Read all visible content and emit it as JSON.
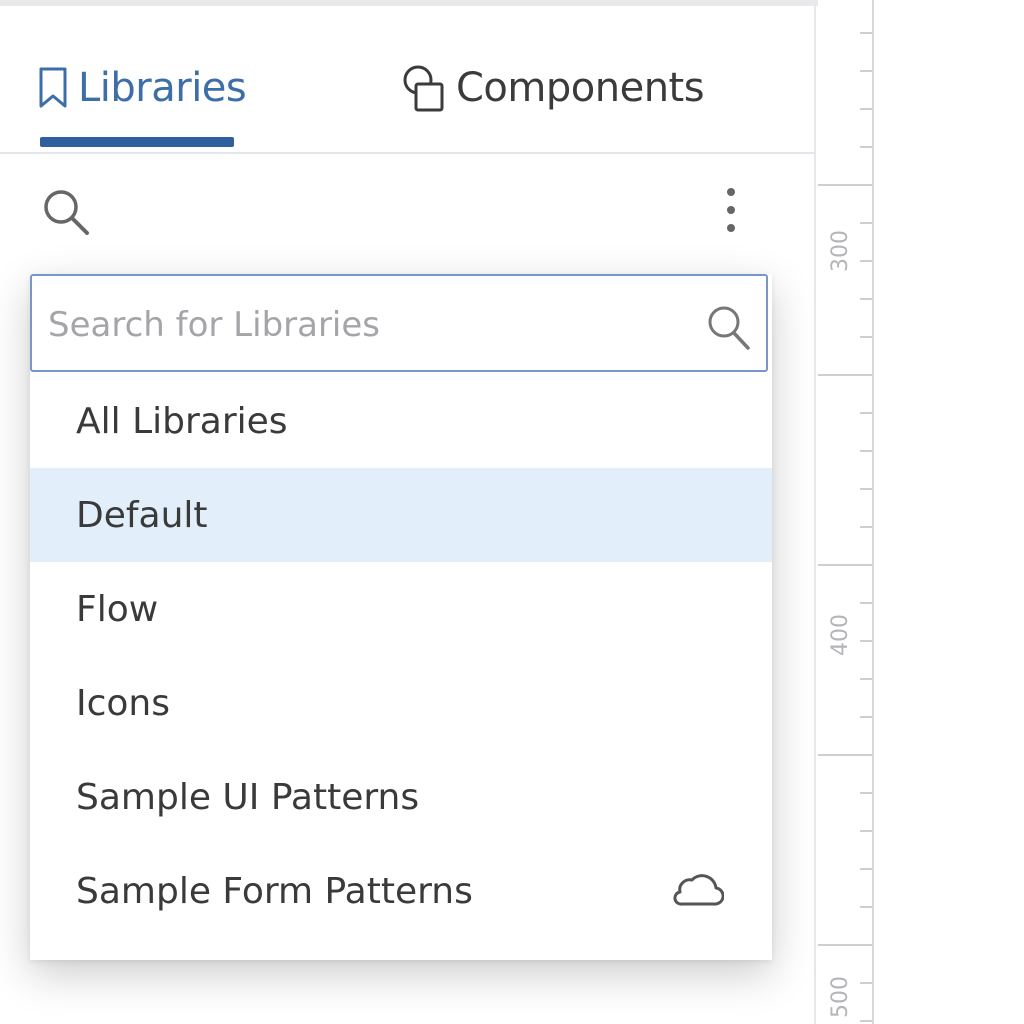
{
  "tabs": [
    {
      "label": "Libraries",
      "icon": "bookmark-icon",
      "active": true
    },
    {
      "label": "Components",
      "icon": "components-icon",
      "active": false
    }
  ],
  "toolbar": {
    "search_icon": "search-icon",
    "menu_icon": "kebab-menu-icon"
  },
  "dropdown": {
    "search": {
      "placeholder": "Search for Libraries",
      "value": "",
      "icon": "search-icon"
    },
    "items": [
      {
        "label": "All Libraries",
        "selected": false
      },
      {
        "label": "Default",
        "selected": true
      },
      {
        "label": "Flow",
        "selected": false
      },
      {
        "label": "Icons",
        "selected": false
      },
      {
        "label": "Sample UI Patterns",
        "selected": false
      },
      {
        "label": "Sample Form Patterns",
        "selected": false,
        "icon": "cloud-icon"
      }
    ]
  },
  "ruler": {
    "labels": [
      "300",
      "400",
      "500"
    ]
  },
  "colors": {
    "accent": "#2f5f9f",
    "active_tab_text": "#3e6ea8",
    "selected_row": "#e2eef9",
    "search_border": "#7a96c8"
  }
}
